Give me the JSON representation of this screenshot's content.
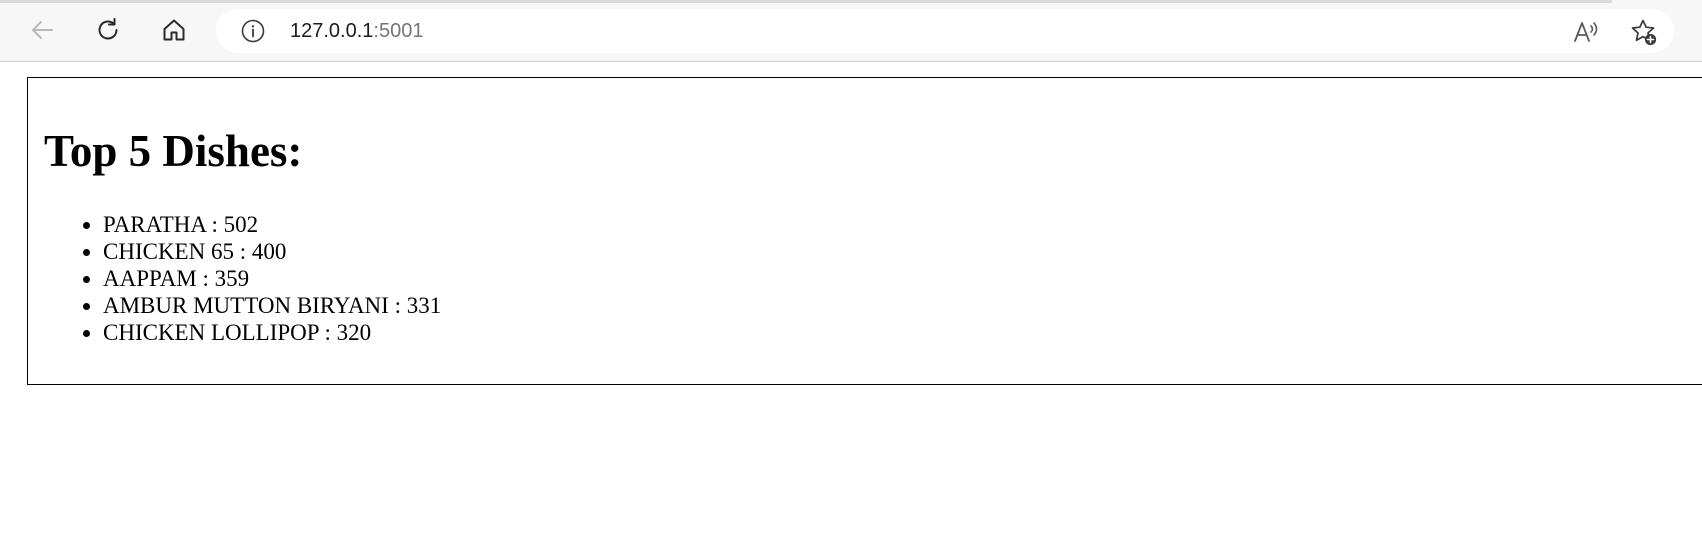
{
  "browser": {
    "url_host": "127.0.0.1",
    "url_port": ":5001",
    "icons": {
      "back": "back-arrow-icon",
      "reload": "reload-icon",
      "home": "home-icon",
      "site_info": "info-icon",
      "read_aloud": "read-aloud-icon",
      "favorite": "favorite-add-icon"
    }
  },
  "page": {
    "title": "Top 5 Dishes:",
    "dishes": [
      {
        "name": "PARATHA",
        "count": 502,
        "text": "PARATHA : 502"
      },
      {
        "name": "CHICKEN 65",
        "count": 400,
        "text": "CHICKEN 65 : 400"
      },
      {
        "name": "AAPPAM",
        "count": 359,
        "text": "AAPPAM : 359"
      },
      {
        "name": "AMBUR MUTTON BIRYANI",
        "count": 331,
        "text": "AMBUR MUTTON BIRYANI : 331"
      },
      {
        "name": "CHICKEN LOLLIPOP",
        "count": 320,
        "text": "CHICKEN LOLLIPOP : 320"
      }
    ]
  }
}
